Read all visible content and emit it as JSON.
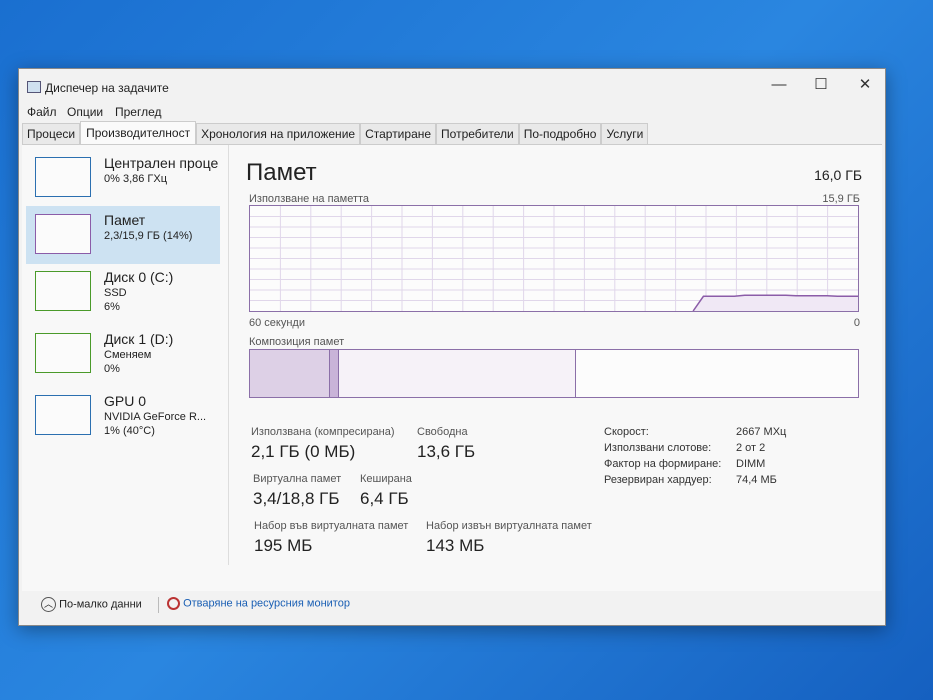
{
  "window": {
    "title": "Диспечер на задачите",
    "minimize": "—",
    "maximize": "☐",
    "close": "✕"
  },
  "menu": [
    "Файл",
    "Опции",
    "Преглед"
  ],
  "tabs": [
    "Процеси",
    "Производителност",
    "Хронология на приложение",
    "Стартиране",
    "Потребители",
    "По-подробно",
    "Услуги"
  ],
  "sidebar": [
    {
      "name": "Централен проце",
      "line1": "0%  3,86 ГХц",
      "line2": "",
      "color": "#2b6fb0"
    },
    {
      "name": "Памет",
      "line1": "2,3/15,9 ГБ (14%)",
      "line2": "",
      "color": "#8b5ca8"
    },
    {
      "name": "Диск 0 (C:)",
      "line1": "SSD",
      "line2": "6%",
      "color": "#4a9a2a"
    },
    {
      "name": "Диск 1 (D:)",
      "line1": "Сменяем",
      "line2": "0%",
      "color": "#4a9a2a"
    },
    {
      "name": "GPU 0",
      "line1": "NVIDIA GeForce R...",
      "line2": "1% (40°C)",
      "color": "#2b6fb0"
    }
  ],
  "main": {
    "title": "Памет",
    "total": "16,0 ГБ",
    "graph_label": "Използване на паметта",
    "graph_max": "15,9 ГБ",
    "time_left": "60 секунди",
    "time_right": "0",
    "comp_label": "Композиция памет",
    "stats": {
      "used_label": "Използвана (компресирана)",
      "used": "2,1 ГБ (0 МБ)",
      "free_label": "Свободна",
      "free": "13,6 ГБ",
      "virt_label": "Виртуална памет",
      "virt": "3,4/18,8 ГБ",
      "cached_label": "Кеширана",
      "cached": "6,4 ГБ",
      "paged_label": "Набор във виртуалната памет",
      "paged": "195 МБ",
      "nonpaged_label": "Набор извън виртуалната памет",
      "nonpaged": "143 МБ"
    },
    "props": [
      [
        "Скорост:",
        "2667 МХц"
      ],
      [
        "Използвани слотове:",
        "2 от 2"
      ],
      [
        "Фактор на формиране:",
        "DIMM"
      ],
      [
        "Резервиран хардуер:",
        "74,4 МБ"
      ]
    ]
  },
  "chart_data": {
    "type": "line",
    "title": "Използване на паметта",
    "ylim": [
      0,
      15.9
    ],
    "xlabel": "60 секунди",
    "values_percent": [
      null,
      null,
      null,
      null,
      null,
      null,
      null,
      null,
      null,
      null,
      null,
      null,
      null,
      null,
      null,
      null,
      null,
      null,
      null,
      null,
      null,
      null,
      null,
      null,
      null,
      null,
      null,
      null,
      null,
      null,
      null,
      null,
      null,
      null,
      null,
      null,
      null,
      null,
      null,
      null,
      null,
      null,
      null,
      0,
      14,
      14,
      14,
      14,
      15,
      15,
      15,
      15,
      15,
      14.5,
      14.5,
      14.5,
      14.5,
      14,
      14,
      14
    ],
    "composition_percent": {
      "in_use": 13,
      "modified": 1.5,
      "standby": 39,
      "free": 46.5
    }
  },
  "footer": {
    "less": "По-малко данни",
    "monitor": "Отваряне на ресурсния монитор"
  }
}
